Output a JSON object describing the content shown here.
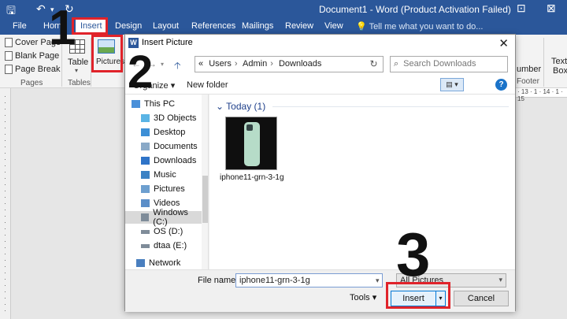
{
  "app": {
    "window_title": "Document1 - Word (Product Activation Failed)",
    "tabs": [
      "File",
      "Home",
      "Insert",
      "Design",
      "Layout",
      "References",
      "Mailings",
      "Review",
      "View"
    ],
    "active_tab": "Insert",
    "tell_me": "Tell me what you want to do..."
  },
  "ribbon": {
    "pages_items": [
      "Cover Page",
      "Blank Page",
      "Page Break"
    ],
    "pages_group": "Pages",
    "table_label": "Table",
    "tables_group": "Tables",
    "pictures_label": "Pictures",
    "right_number": "umber",
    "right_footer": "Footer",
    "right_text": "Text",
    "right_box": "Box",
    "ruler_text": "· 13 · 1 · 14 · 1 · 15"
  },
  "steps": [
    "1",
    "2",
    "3"
  ],
  "dialog": {
    "title": "Insert Picture",
    "title_icon": "W",
    "close": "✕",
    "path": [
      "Users",
      "Admin",
      "Downloads"
    ],
    "path_prefix": "«",
    "search_placeholder": "Search Downloads",
    "organize": "Organize",
    "new_folder": "New folder",
    "help": "?",
    "nav_items": [
      {
        "label": "This PC",
        "icon": "pc-icon",
        "color": "#4a90d9"
      },
      {
        "label": "3D Objects",
        "icon": "cube-icon",
        "color": "#5ab4e5"
      },
      {
        "label": "Desktop",
        "icon": "desktop-icon",
        "color": "#3d8fd6"
      },
      {
        "label": "Documents",
        "icon": "document-icon",
        "color": "#8aa9c7"
      },
      {
        "label": "Downloads",
        "icon": "download-icon",
        "color": "#2f74c8"
      },
      {
        "label": "Music",
        "icon": "music-icon",
        "color": "#3b82c4"
      },
      {
        "label": "Pictures",
        "icon": "pictures-icon",
        "color": "#6d9fcf"
      },
      {
        "label": "Videos",
        "icon": "video-icon",
        "color": "#5b8ec8"
      },
      {
        "label": "Windows (C:)",
        "icon": "drive-icon",
        "color": "#7f8c99"
      },
      {
        "label": "OS (D:)",
        "icon": "drive-icon",
        "color": "#7f8c99"
      },
      {
        "label": "dtaa (E:)",
        "icon": "drive-icon",
        "color": "#7f8c99"
      },
      {
        "label": "Network",
        "icon": "network-icon",
        "color": "#4a7fbf"
      }
    ],
    "selected_nav": "Windows (C:)",
    "group_header": "Today (1)",
    "files": [
      {
        "name": "iphone11-grn-3-1g"
      }
    ],
    "file_name_label": "File name:",
    "file_name_value": "iphone11-grn-3-1g",
    "file_type": "All Pictures",
    "tools": "Tools",
    "insert": "Insert",
    "cancel": "Cancel"
  }
}
